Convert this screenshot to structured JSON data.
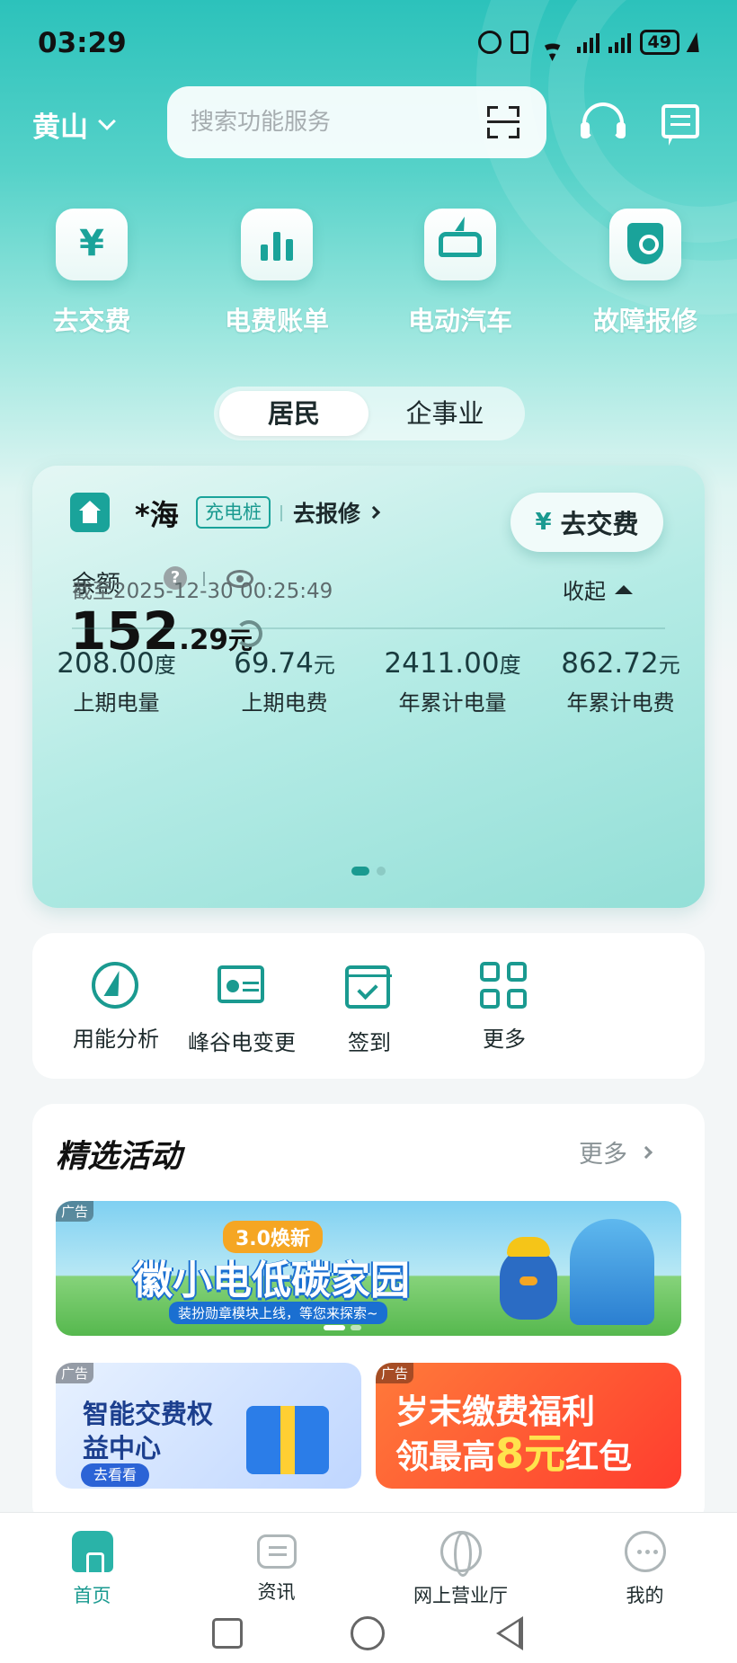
{
  "status_bar": {
    "time": "03:29",
    "battery": "49",
    "icons": [
      "alarm-icon",
      "vibrate-icon",
      "wifi-icon",
      "signal-icon",
      "signal-icon",
      "battery-icon",
      "charging-icon"
    ]
  },
  "header": {
    "city": "黄山",
    "search_placeholder": "搜索功能服务",
    "icons": [
      "scan-icon",
      "customer-service-icon",
      "message-icon"
    ]
  },
  "quick_actions": [
    {
      "label": "去交费",
      "icon": "yen-icon"
    },
    {
      "label": "电费账单",
      "icon": "bar-chart-icon"
    },
    {
      "label": "电动汽车",
      "icon": "ev-car-icon"
    },
    {
      "label": "故障报修",
      "icon": "wrench-shield-icon"
    }
  ],
  "segment": {
    "tabs": [
      "居民",
      "企事业"
    ],
    "active": "居民"
  },
  "account": {
    "name": "*海",
    "tag": "充电桩",
    "repair_link": "去报修",
    "pay_button": "去交费",
    "pay_icon": "¥",
    "balance_label": "余额",
    "help_glyph": "?",
    "balance_int": "152",
    "balance_dec": ".29",
    "balance_unit": "元",
    "as_of": "截至2025-12-30 00:25:49",
    "collapse_label": "收起",
    "stats": [
      {
        "value": "208.00",
        "unit": "度",
        "label": "上期电量"
      },
      {
        "value": "69.74",
        "unit": "元",
        "label": "上期电费"
      },
      {
        "value": "2411.00",
        "unit": "度",
        "label": "年累计电量"
      },
      {
        "value": "862.72",
        "unit": "元",
        "label": "年累计电费"
      }
    ],
    "page_count": 2,
    "active_page": 1
  },
  "functions": [
    {
      "label": "用能分析",
      "icon": "energy-analysis-icon"
    },
    {
      "label": "峰谷电变更",
      "icon": "peak-valley-icon"
    },
    {
      "label": "签到",
      "icon": "calendar-check-icon"
    },
    {
      "label": "更多",
      "icon": "grid-icon"
    }
  ],
  "featured": {
    "title": "精选活动",
    "more": "更多",
    "ad_tag": "广告",
    "banner": {
      "badge": "3.0焕新",
      "title": "徽小电低碳家园",
      "subtitle": "装扮勋章模块上线，等您来探索~"
    },
    "sub_banners": [
      {
        "title": "智能交费权益中心",
        "button": "去看看"
      },
      {
        "title_part1": "岁末缴费福利",
        "title_part2": "领最高",
        "title_highlight": "8元",
        "title_part3": "红包"
      }
    ]
  },
  "bottom_nav": [
    {
      "label": "首页",
      "icon": "home-icon",
      "active": true
    },
    {
      "label": "资讯",
      "icon": "news-icon",
      "active": false
    },
    {
      "label": "网上营业厅",
      "icon": "globe-icon",
      "active": false
    },
    {
      "label": "我的",
      "icon": "profile-icon",
      "active": false
    }
  ],
  "colors": {
    "primary": "#1a9a90",
    "hero": "#2cc2bb",
    "card": "#b4ebe5"
  }
}
